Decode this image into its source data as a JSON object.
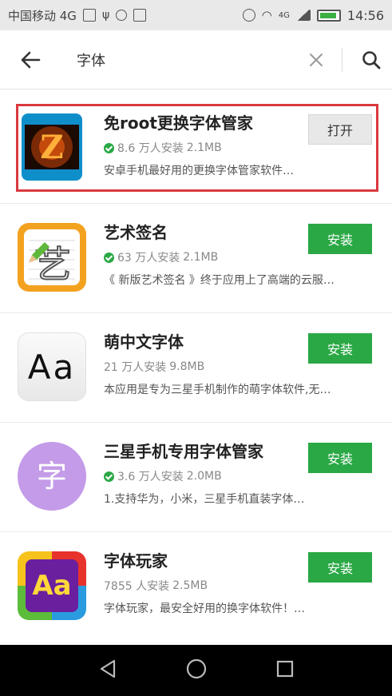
{
  "status_bar": {
    "carrier": "中国移动 4G",
    "network": "4G",
    "time": "14:56"
  },
  "search": {
    "query": "字体"
  },
  "apps": [
    {
      "name": "免root更换字体管家",
      "verified": true,
      "installs": "8.6 万人安装",
      "size": "2.1MB",
      "description": "安卓手机最好用的更换字体管家软件…",
      "button_label": "打开",
      "icon": "fire-z-icon",
      "highlighted": true
    },
    {
      "name": "艺术签名",
      "verified": true,
      "installs": "63 万人安装",
      "size": "2.1MB",
      "description": "《 新版艺术签名 》终于应用上了高端的云服…",
      "button_label": "安装",
      "icon": "art-signature-icon",
      "highlighted": false
    },
    {
      "name": "萌中文字体",
      "verified": false,
      "installs": "21 万人安装",
      "size": "9.8MB",
      "description": "本应用是专为三星手机制作的萌字体软件,无…",
      "button_label": "安装",
      "icon": "aa-font-icon",
      "glyph": "Aa",
      "highlighted": false
    },
    {
      "name": "三星手机专用字体管家",
      "verified": true,
      "installs": "3.6 万人安装",
      "size": "2.0MB",
      "description": "1.支持华为，小米，三星手机直装字体…",
      "button_label": "安装",
      "icon": "zi-character-icon",
      "glyph": "字",
      "highlighted": false
    },
    {
      "name": "字体玩家",
      "verified": false,
      "installs": "7855 人安装",
      "size": "2.5MB",
      "description": "字体玩家，最安全好用的换字体软件！…",
      "button_label": "安装",
      "icon": "colorful-aa-icon",
      "glyph": "Aa",
      "highlighted": false
    }
  ],
  "colors": {
    "install_green": "#2aa845",
    "highlight_red": "#d9393e",
    "purple_icon": "#c49be8"
  }
}
